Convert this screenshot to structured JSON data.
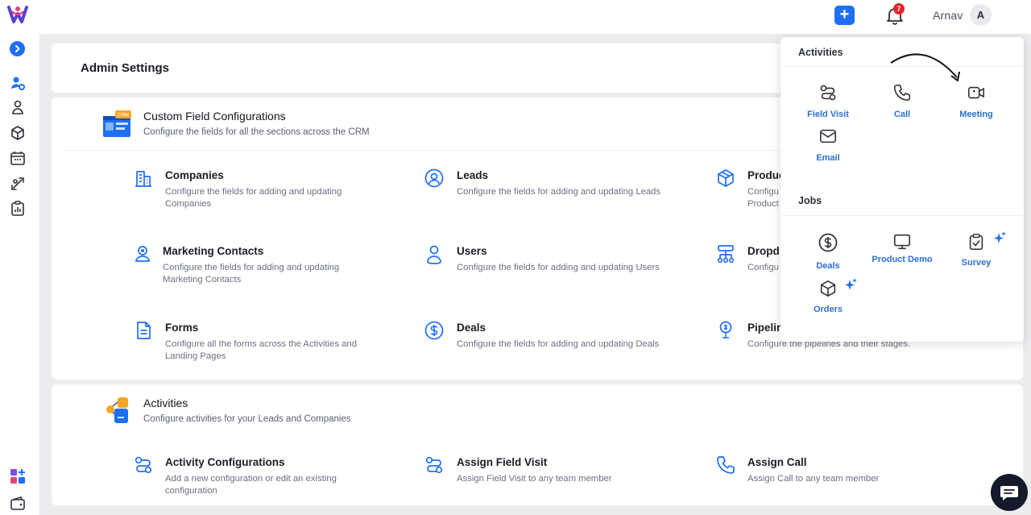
{
  "topbar": {
    "add_label": "+",
    "notification_count": "7",
    "user_name": "Arnav",
    "avatar_initial": "A"
  },
  "sidebar": {
    "toggle_icon": "chevron-right-icon",
    "items": [
      "admin-settings-icon",
      "contacts-icon",
      "products-icon",
      "calendar-icon",
      "integrations-icon",
      "reports-icon"
    ],
    "bottom": [
      "apps-icon",
      "wallet-icon"
    ]
  },
  "page": {
    "title": "Admin Settings"
  },
  "custom_fields": {
    "title": "Custom Field Configurations",
    "subtitle": "Configure the fields for all the sections across the CRM",
    "items": [
      {
        "title": "Companies",
        "desc": "Configure the fields for adding and updating Companies",
        "icon": "building-icon"
      },
      {
        "title": "Leads",
        "desc": "Configure the fields for adding and updating Leads",
        "icon": "user-circle-icon"
      },
      {
        "title": "Produc",
        "desc": "Configu Product",
        "icon": "box-icon"
      },
      {
        "title": "Marketing Contacts",
        "desc": "Configure the fields for adding and updating Marketing Contacts",
        "icon": "user-badge-icon"
      },
      {
        "title": "Users",
        "desc": "Configure the fields for adding and updating Users",
        "icon": "user-icon"
      },
      {
        "title": "Dropd",
        "desc": "Configu",
        "icon": "hierarchy-icon"
      },
      {
        "title": "Forms",
        "desc": "Configure all the forms across the Activities and Landing Pages",
        "icon": "document-icon"
      },
      {
        "title": "Deals",
        "desc": "Configure the fields for adding and updating Deals",
        "icon": "dollar-icon"
      },
      {
        "title": "Pipelin",
        "desc": "Configure the pipelines and their stages.",
        "icon": "pipeline-icon"
      }
    ]
  },
  "activities_section": {
    "title": "Activities",
    "subtitle": "Configure activities for your Leads and Companies",
    "items": [
      {
        "title": "Activity Configurations",
        "desc": "Add a new configuration or edit an existing configuration",
        "icon": "route-icon"
      },
      {
        "title": "Assign Field Visit",
        "desc": "Assign Field Visit to any team member",
        "icon": "route-icon"
      },
      {
        "title": "Assign Call",
        "desc": "Assign Call to any team member",
        "icon": "phone-icon"
      }
    ]
  },
  "popup": {
    "activities_heading": "Activities",
    "activities": [
      {
        "label": "Field Visit",
        "icon": "route-icon"
      },
      {
        "label": "Call",
        "icon": "phone-icon"
      },
      {
        "label": "Meeting",
        "icon": "video-icon"
      },
      {
        "label": "Email",
        "icon": "mail-icon"
      }
    ],
    "jobs_heading": "Jobs",
    "jobs": [
      {
        "label": "Deals",
        "icon": "dollar-icon"
      },
      {
        "label": "Product Demo",
        "icon": "monitor-icon"
      },
      {
        "label": "Survey",
        "icon": "clipboard-check-icon"
      },
      {
        "label": "Orders",
        "icon": "box-icon"
      }
    ]
  },
  "colors": {
    "accent": "#1f6ff2",
    "link": "#2c6fd1",
    "badge": "#e2262b"
  }
}
